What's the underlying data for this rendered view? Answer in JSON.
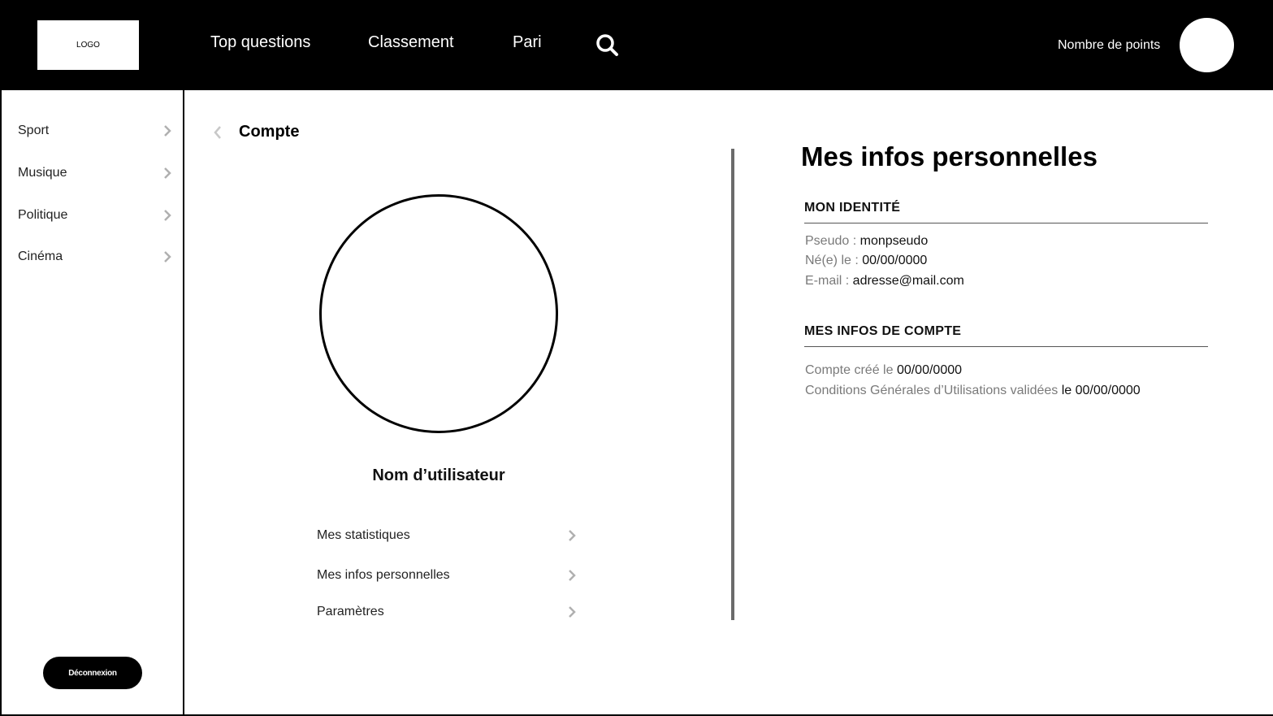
{
  "header": {
    "logo": "LOGO",
    "nav": [
      "Top questions",
      "Classement",
      "Pari"
    ],
    "points_label": "Nombre de points"
  },
  "sidebar": {
    "items": [
      "Sport",
      "Musique",
      "Politique",
      "Cinéma"
    ],
    "logout": "Déconnexion"
  },
  "account": {
    "title": "Compte",
    "username": "Nom d’utilisateur",
    "menu": [
      "Mes statistiques",
      "Mes infos personnelles",
      "Paramètres"
    ]
  },
  "personal_info": {
    "title": "Mes infos personnelles",
    "identity": {
      "heading": "MON IDENTITÉ",
      "pseudo_label": "Pseudo : ",
      "pseudo_value": "monpseudo",
      "birth_label": "Né(e) le : ",
      "birth_value": "00/00/0000",
      "email_label": "E-mail : ",
      "email_value": "adresse@mail.com"
    },
    "account_info": {
      "heading": "MES INFOS DE COMPTE",
      "created_label": "Compte créé le ",
      "created_value": "00/00/0000",
      "cgu_label": "Conditions Générales d’Utilisations validées ",
      "cgu_value": "le 00/00/0000"
    }
  },
  "colors": {
    "header_bg": "#000000",
    "divider": "#6b6b6b",
    "muted_text": "#7a7a7a",
    "chevron": "#b0b0b0"
  },
  "icons": {
    "search": "search-icon",
    "chevron": "chevron-right-icon",
    "back": "chevron-left-icon"
  }
}
